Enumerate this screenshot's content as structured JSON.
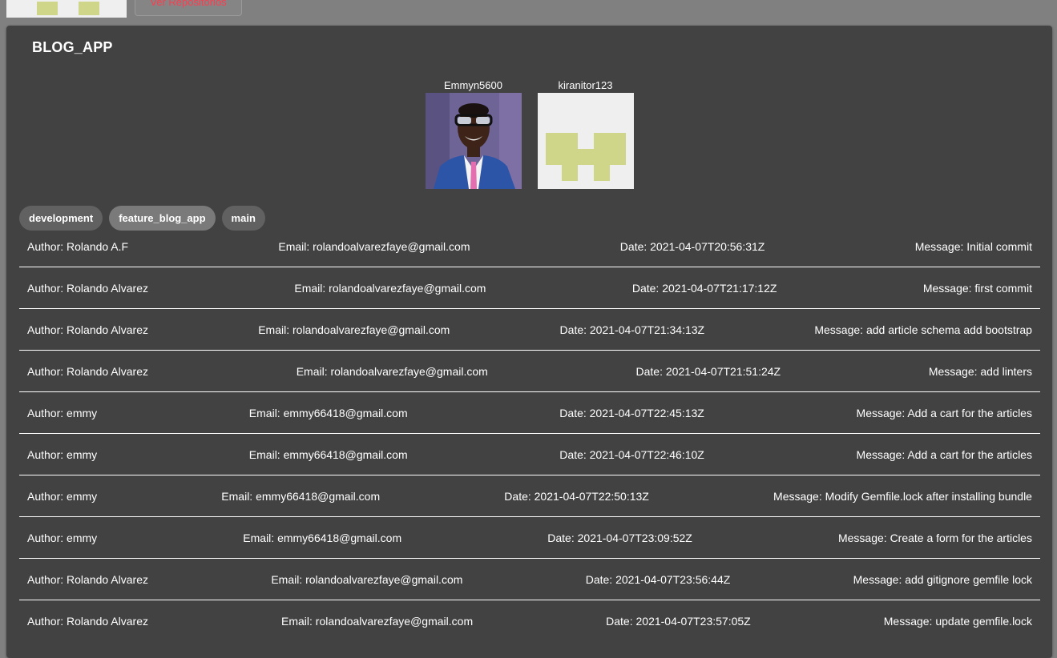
{
  "header": {
    "repos_button_label": "Ver Repositorios"
  },
  "repo": {
    "title": "BLOG_APP"
  },
  "contributors": [
    {
      "name": "Emmyn5600",
      "avatar": "photo"
    },
    {
      "name": "kiranitor123",
      "avatar": "identicon"
    }
  ],
  "branches": [
    {
      "label": "development"
    },
    {
      "label": "feature_blog_app"
    },
    {
      "label": "main"
    }
  ],
  "commits": [
    {
      "author": "Author: Rolando A.F",
      "email": "Email: rolandoalvarezfaye@gmail.com",
      "date": "Date: 2021-04-07T20:56:31Z",
      "message": "Message: Initial commit"
    },
    {
      "author": "Author: Rolando Alvarez",
      "email": "Email: rolandoalvarezfaye@gmail.com",
      "date": "Date: 2021-04-07T21:17:12Z",
      "message": "Message: first commit"
    },
    {
      "author": "Author: Rolando Alvarez",
      "email": "Email: rolandoalvarezfaye@gmail.com",
      "date": "Date: 2021-04-07T21:34:13Z",
      "message": "Message: add article schema add bootstrap"
    },
    {
      "author": "Author: Rolando Alvarez",
      "email": "Email: rolandoalvarezfaye@gmail.com",
      "date": "Date: 2021-04-07T21:51:24Z",
      "message": "Message: add linters"
    },
    {
      "author": "Author: emmy",
      "email": "Email: emmy66418@gmail.com",
      "date": "Date: 2021-04-07T22:45:13Z",
      "message": "Message: Add a cart for the articles"
    },
    {
      "author": "Author: emmy",
      "email": "Email: emmy66418@gmail.com",
      "date": "Date: 2021-04-07T22:46:10Z",
      "message": "Message: Add a cart for the articles"
    },
    {
      "author": "Author: emmy",
      "email": "Email: emmy66418@gmail.com",
      "date": "Date: 2021-04-07T22:50:13Z",
      "message": "Message: Modify Gemfile.lock after installing bundle"
    },
    {
      "author": "Author: emmy",
      "email": "Email: emmy66418@gmail.com",
      "date": "Date: 2021-04-07T23:09:52Z",
      "message": "Message: Create a form for the articles"
    },
    {
      "author": "Author: Rolando Alvarez",
      "email": "Email: rolandoalvarezfaye@gmail.com",
      "date": "Date: 2021-04-07T23:56:44Z",
      "message": "Message: add gitignore gemfile lock"
    },
    {
      "author": "Author: Rolando Alvarez",
      "email": "Email: rolandoalvarezfaye@gmail.com",
      "date": "Date: 2021-04-07T23:57:05Z",
      "message": "Message: update gemfile.lock"
    }
  ],
  "colors": {
    "background": "#808080",
    "card": "#424242",
    "chip": "#616161",
    "repos_button_text": "#ff3b4e",
    "identicon_fg": "#cfd68a",
    "identicon_bg": "#efefef"
  }
}
